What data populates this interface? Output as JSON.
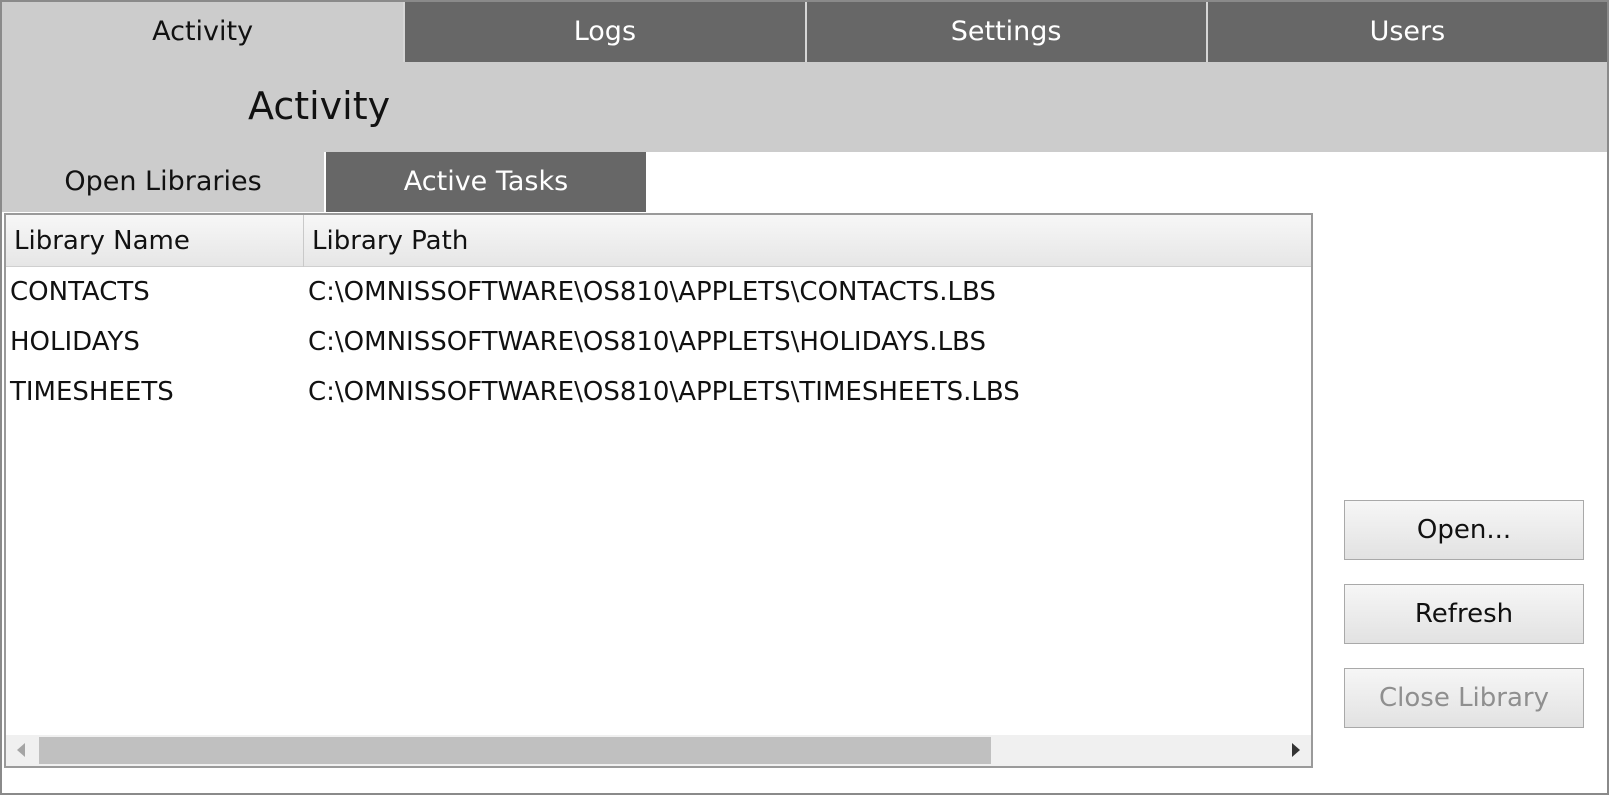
{
  "top_tabs": [
    {
      "label": "Activity",
      "active": true
    },
    {
      "label": "Logs",
      "active": false
    },
    {
      "label": "Settings",
      "active": false
    },
    {
      "label": "Users",
      "active": false
    }
  ],
  "page_title": "Activity",
  "sub_tabs": [
    {
      "label": "Open Libraries",
      "active": true
    },
    {
      "label": "Active Tasks",
      "active": false
    }
  ],
  "grid": {
    "columns": [
      "Library Name",
      "Library Path"
    ],
    "rows": [
      {
        "name": "CONTACTS",
        "path": "C:\\OMNISSOFTWARE\\OS810\\APPLETS\\CONTACTS.LBS"
      },
      {
        "name": "HOLIDAYS",
        "path": "C:\\OMNISSOFTWARE\\OS810\\APPLETS\\HOLIDAYS.LBS"
      },
      {
        "name": "TIMESHEETS",
        "path": "C:\\OMNISSOFTWARE\\OS810\\APPLETS\\TIMESHEETS.LBS"
      }
    ]
  },
  "buttons": {
    "open": "Open...",
    "refresh": "Refresh",
    "close_library": "Close Library"
  },
  "colors": {
    "tab_inactive": "#676767",
    "tab_active": "#cccccc",
    "title_band": "#cccccc",
    "disabled_text": "#8f8f8f"
  }
}
